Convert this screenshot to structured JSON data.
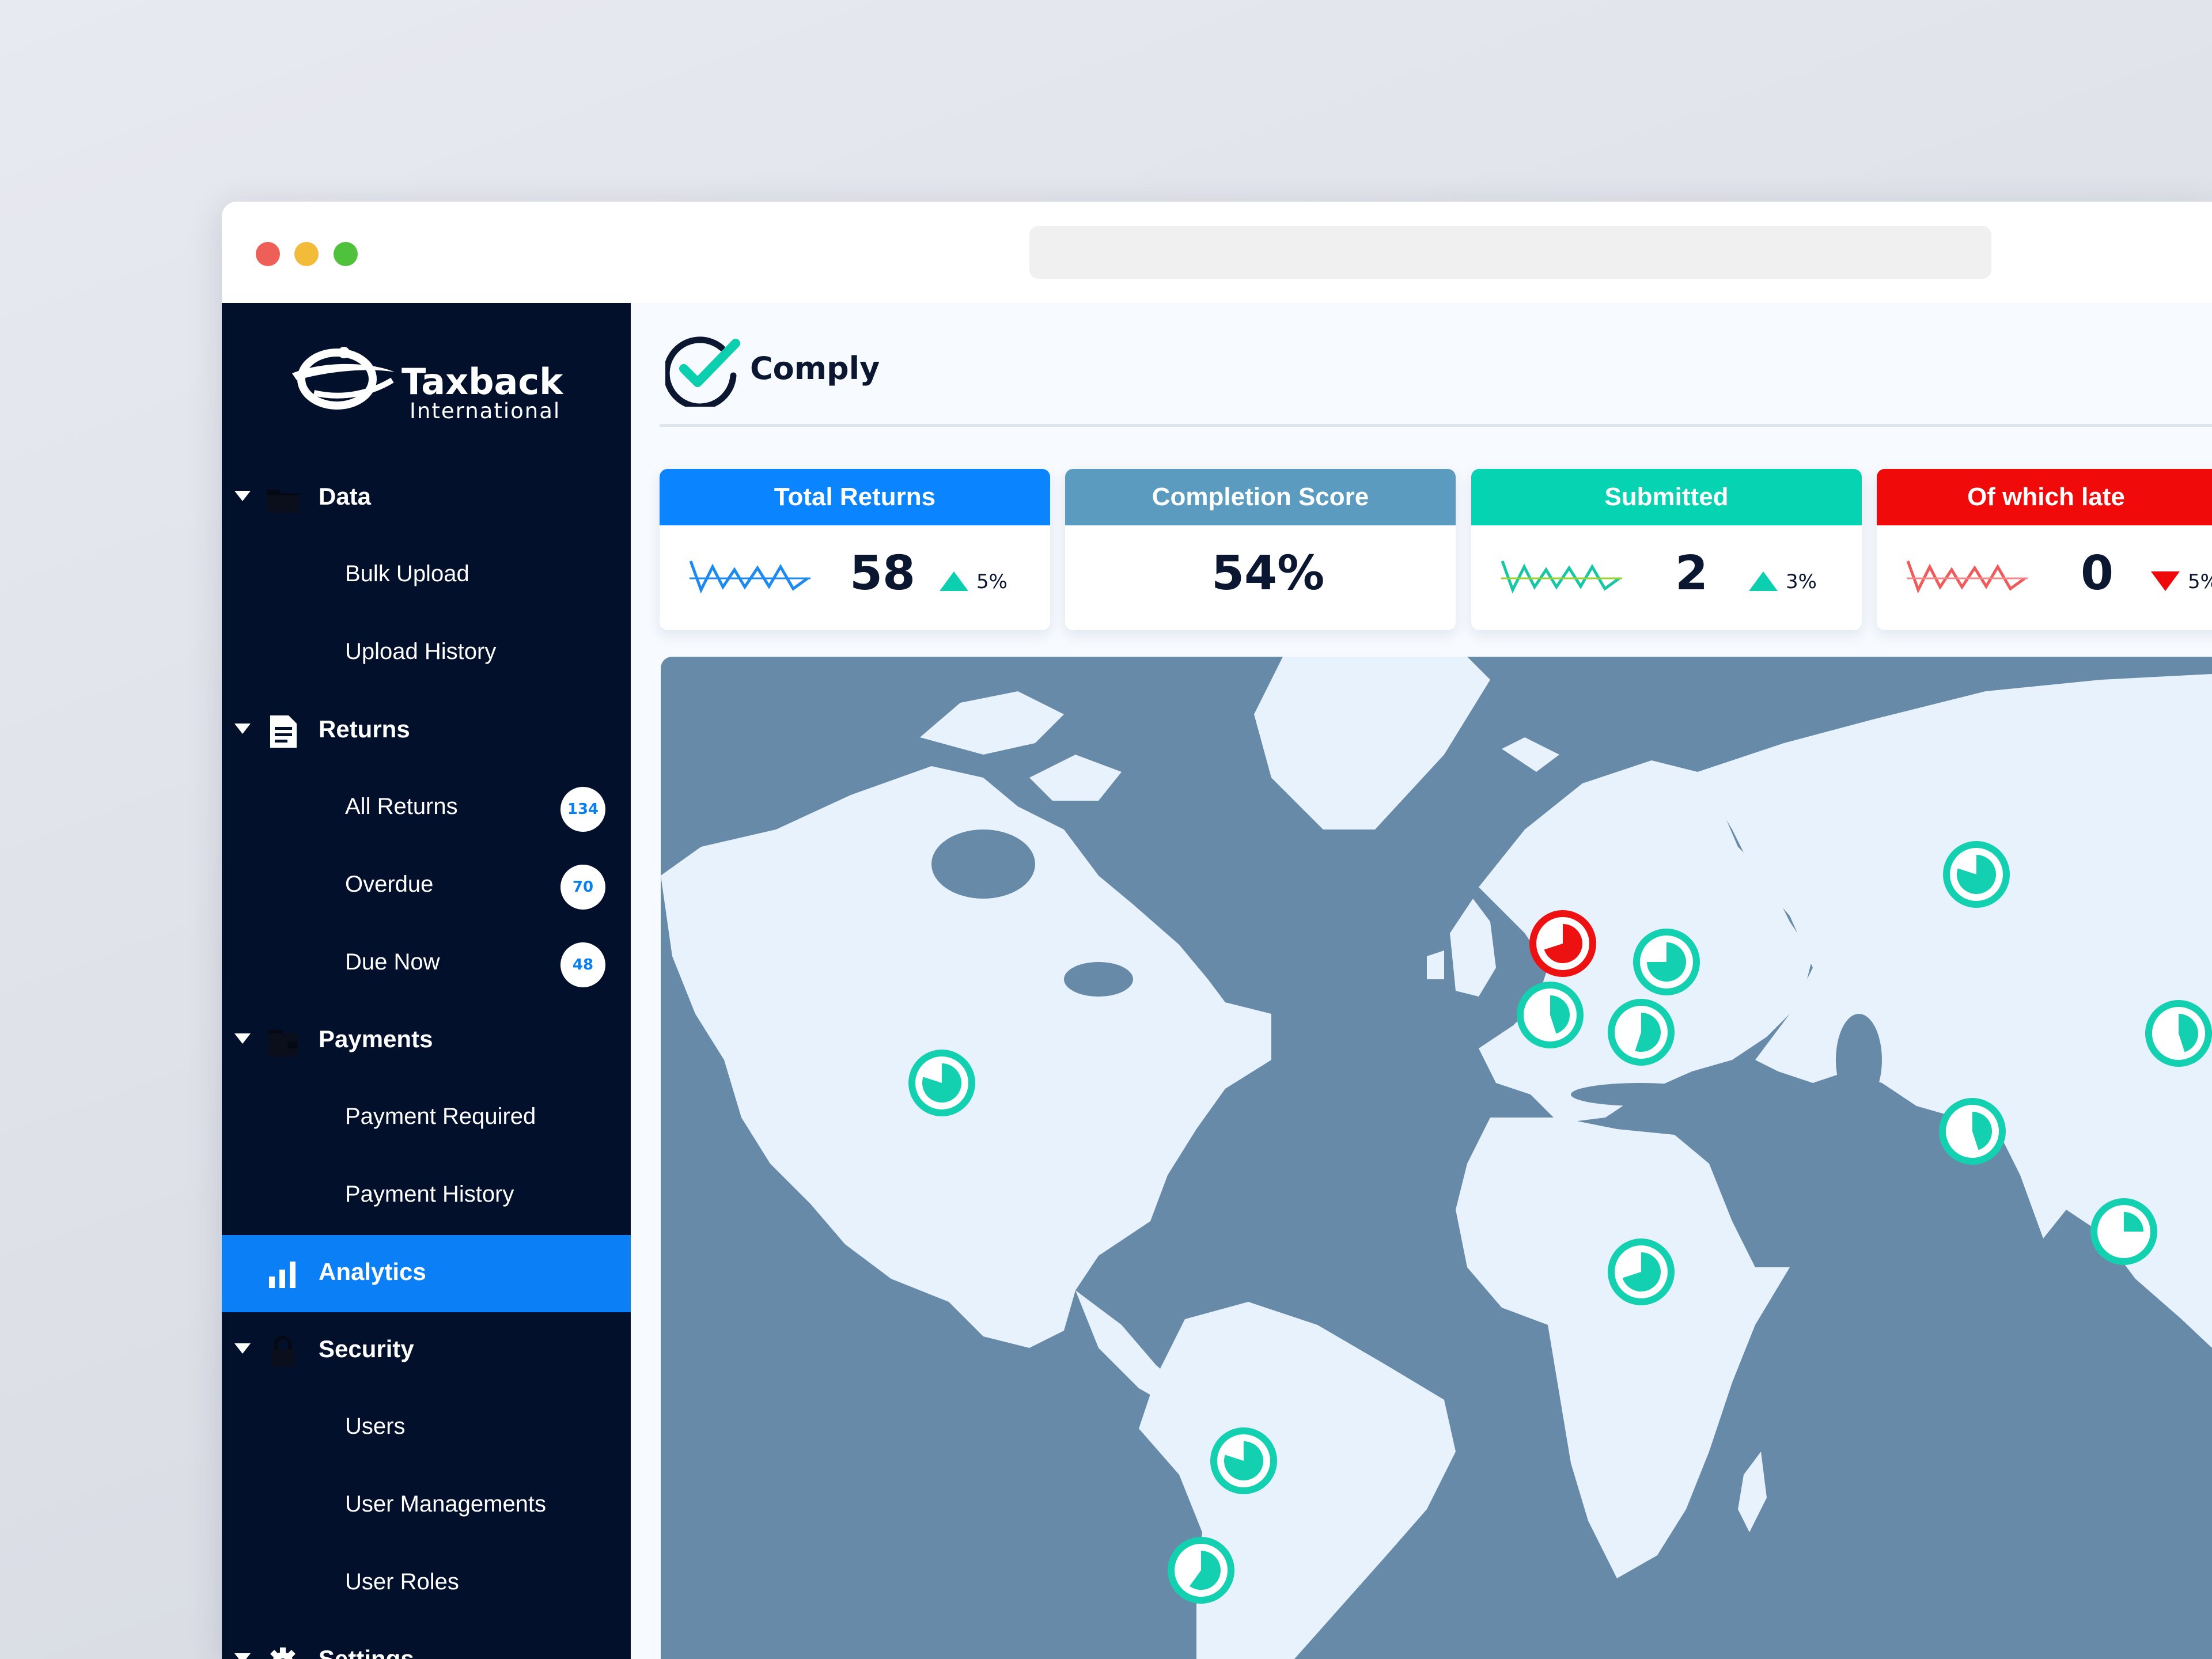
{
  "brand": {
    "name": "Taxback",
    "sub": "International"
  },
  "app": {
    "name": "Comply"
  },
  "sidebar": {
    "sections": [
      {
        "label": "Data",
        "icon": "folder-icon",
        "items": [
          {
            "label": "Bulk Upload"
          },
          {
            "label": "Upload History"
          }
        ]
      },
      {
        "label": "Returns",
        "icon": "document-icon",
        "items": [
          {
            "label": "All Returns",
            "badge": "134"
          },
          {
            "label": "Overdue",
            "badge": "70"
          },
          {
            "label": "Due Now",
            "badge": "48"
          }
        ]
      },
      {
        "label": "Payments",
        "icon": "wallet-icon",
        "items": [
          {
            "label": "Payment Required"
          },
          {
            "label": "Payment History"
          }
        ]
      },
      {
        "label": "Analytics",
        "icon": "bar-chart-icon",
        "active": true,
        "items": []
      },
      {
        "label": "Security",
        "icon": "lock-icon",
        "items": [
          {
            "label": "Users"
          },
          {
            "label": "User Managements"
          },
          {
            "label": "User Roles"
          }
        ]
      },
      {
        "label": "Settings",
        "icon": "gear-icon",
        "items": []
      }
    ]
  },
  "cards": [
    {
      "title": "Total Returns",
      "value": "58",
      "change": "5%",
      "direction": "up",
      "color": "#0a84ff",
      "spark_color": "#1e8af0"
    },
    {
      "title": "Completion Score",
      "value": "54%",
      "color": "#5a9bbf"
    },
    {
      "title": "Submitted",
      "value": "2",
      "change": "3%",
      "direction": "up",
      "color": "#06d3b2",
      "spark_color": "#2fc86a"
    },
    {
      "title": "Of which late",
      "value": "0",
      "change": "5%",
      "direction": "down",
      "color": "#f00a0a",
      "spark_color": "#f05a5a"
    }
  ],
  "map": {
    "ocean_color": "#678aa8",
    "land_color": "#e8f2fd",
    "markers": [
      {
        "name": "usa",
        "status": "ok",
        "fill": 0.8
      },
      {
        "name": "uk",
        "status": "late",
        "fill": 0.7
      },
      {
        "name": "france",
        "status": "ok",
        "fill": 0.45
      },
      {
        "name": "poland",
        "status": "ok",
        "fill": 0.75
      },
      {
        "name": "italy",
        "status": "ok",
        "fill": 0.55
      },
      {
        "name": "russia",
        "status": "ok",
        "fill": 0.8
      },
      {
        "name": "kazakhstan",
        "status": "ok",
        "fill": 0.45
      },
      {
        "name": "pakistan",
        "status": "ok",
        "fill": 0.45
      },
      {
        "name": "india",
        "status": "ok",
        "fill": 0.25
      },
      {
        "name": "chad",
        "status": "ok",
        "fill": 0.7
      },
      {
        "name": "brazil",
        "status": "ok",
        "fill": 0.8
      },
      {
        "name": "argentina",
        "status": "ok",
        "fill": 0.6
      }
    ]
  }
}
